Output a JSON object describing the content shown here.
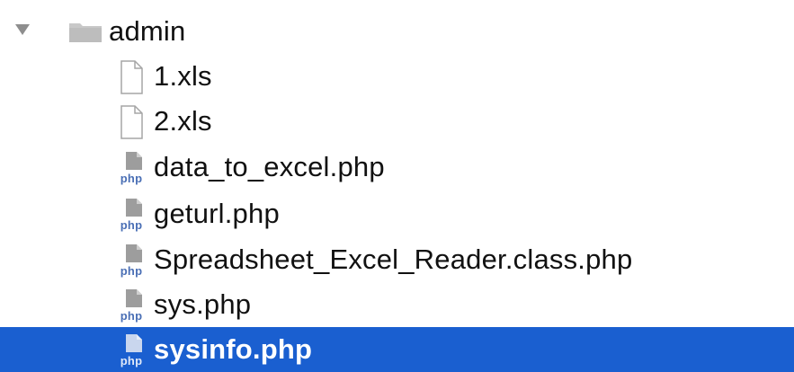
{
  "tree": {
    "folder": {
      "label": "admin",
      "icon": "folder-icon",
      "expanded": true
    },
    "items": [
      {
        "label": "1.xls",
        "icon": "document-icon",
        "selected": false
      },
      {
        "label": "2.xls",
        "icon": "document-icon",
        "selected": false
      },
      {
        "label": "data_to_excel.php",
        "icon": "php-file-icon",
        "selected": false
      },
      {
        "label": "geturl.php",
        "icon": "php-file-icon",
        "selected": false
      },
      {
        "label": "Spreadsheet_Excel_Reader.class.php",
        "icon": "php-file-icon",
        "selected": false
      },
      {
        "label": "sys.php",
        "icon": "php-file-icon",
        "selected": false
      },
      {
        "label": "sysinfo.php",
        "icon": "php-file-icon",
        "selected": true
      }
    ],
    "php_badge_text": "php",
    "colors": {
      "selection": "#1a5fd0",
      "text": "#111111",
      "selected_text": "#ffffff",
      "disclosure": "#8e8e8e",
      "folder": "#c8c8c8"
    }
  }
}
